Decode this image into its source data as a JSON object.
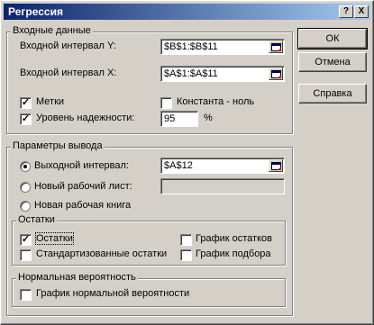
{
  "window": {
    "title": "Регрессия",
    "help_btn": "?",
    "close_btn": "X"
  },
  "input_group": {
    "legend": "Входные данные",
    "y_label": "Входной интервал Y:",
    "y_value": "$B$1:$B$11",
    "x_label": "Входной интервал X:",
    "x_value": "$A$1:$A$11",
    "labels_label": "Метки",
    "labels_checked": true,
    "constant_label": "Константа - ноль",
    "constant_checked": false,
    "confidence_label": "Уровень надежности:",
    "confidence_checked": true,
    "confidence_value": "95",
    "percent_sign": "%"
  },
  "output_group": {
    "legend": "Параметры вывода",
    "range_label": "Выходной интервал:",
    "range_value": "$A$12",
    "range_selected": true,
    "new_sheet_label": "Новый рабочий лист:",
    "new_sheet_value": "",
    "new_workbook_label": "Новая рабочая книга"
  },
  "residuals_group": {
    "legend": "Остатки",
    "residuals_label": "Остатки",
    "residuals_checked": true,
    "std_residuals_label": "Стандартизованные остатки",
    "residual_plot_label": "График остатков",
    "fit_plot_label": "График подбора"
  },
  "normal_group": {
    "legend": "Нормальная вероятность",
    "normal_plot_label": "График нормальной вероятности"
  },
  "buttons": {
    "ok": "ОК",
    "cancel": "Отмена",
    "help": "Справка"
  }
}
